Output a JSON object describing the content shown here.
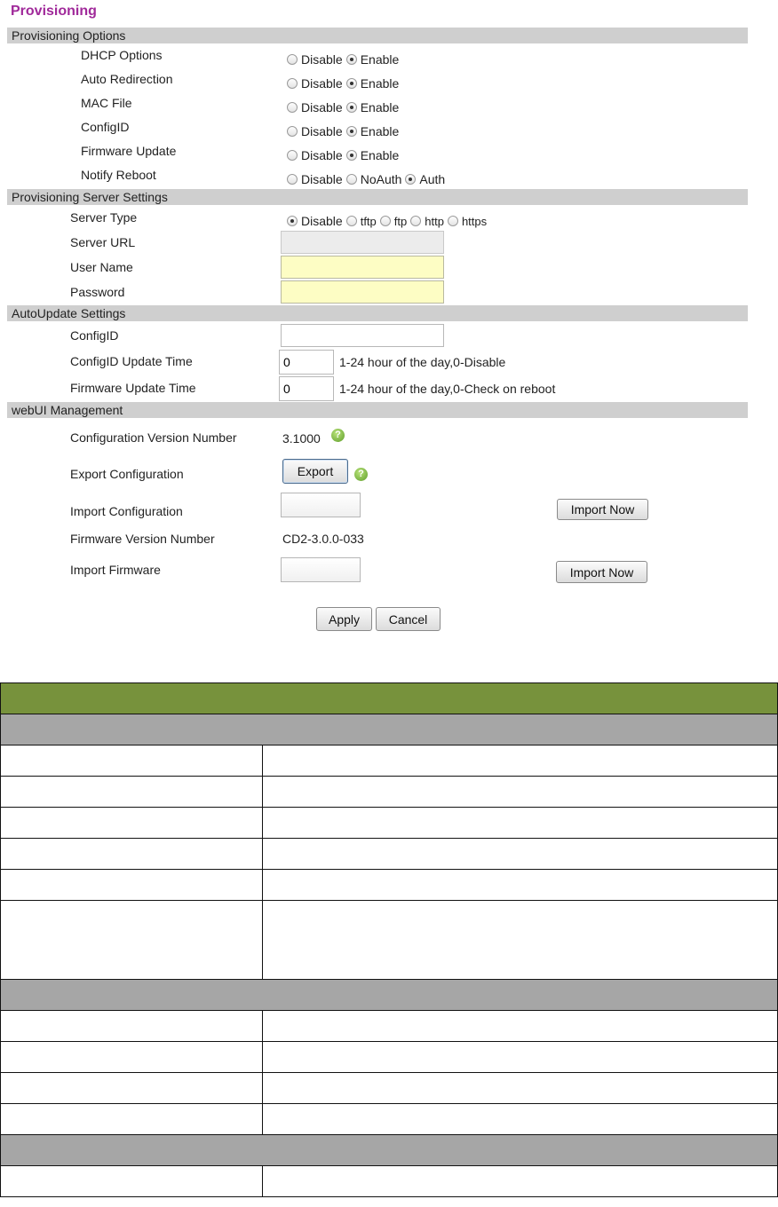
{
  "page_title": "Provisioning",
  "sections": {
    "options": "Provisioning Options",
    "server": "Provisioning Server Settings",
    "autoupdate": "AutoUpdate Settings",
    "webui": "webUI Management"
  },
  "provisioning_options": [
    {
      "label": "DHCP Options",
      "options": [
        "Disable",
        "Enable"
      ],
      "selected": "Enable"
    },
    {
      "label": "Auto Redirection",
      "options": [
        "Disable",
        "Enable"
      ],
      "selected": "Enable"
    },
    {
      "label": "MAC File",
      "options": [
        "Disable",
        "Enable"
      ],
      "selected": "Enable"
    },
    {
      "label": "ConfigID",
      "options": [
        "Disable",
        "Enable"
      ],
      "selected": "Enable"
    },
    {
      "label": "Firmware Update",
      "options": [
        "Disable",
        "Enable"
      ],
      "selected": "Enable"
    },
    {
      "label": "Notify Reboot",
      "options": [
        "Disable",
        "NoAuth",
        "Auth"
      ],
      "selected": "Auth"
    }
  ],
  "server_settings": {
    "server_type_label": "Server Type",
    "server_type_options": [
      "Disable",
      "tftp",
      "ftp",
      "http",
      "https"
    ],
    "server_type_selected": "Disable",
    "server_url_label": "Server URL",
    "server_url_value": "",
    "user_name_label": "User Name",
    "user_name_value": "",
    "password_label": "Password",
    "password_value": ""
  },
  "autoupdate": {
    "configid_label": "ConfigID",
    "configid_value": "",
    "configid_time_label": "ConfigID Update Time",
    "configid_time_value": "0",
    "configid_time_hint": "1-24 hour of the day,0-Disable",
    "fw_time_label": "Firmware Update Time",
    "fw_time_value": "0",
    "fw_time_hint": "1-24 hour of the day,0-Check on reboot"
  },
  "webui": {
    "config_version_label": "Configuration Version Number",
    "config_version_value": "3.1000",
    "export_label": "Export Configuration",
    "export_button": "Export",
    "import_config_label": "Import Configuration",
    "import_now_button": "Import Now",
    "fw_version_label": "Firmware Version Number",
    "fw_version_value": "CD2-3.0.0-033",
    "import_fw_label": "Import Firmware",
    "import_fw_button": "Import Now"
  },
  "footer": {
    "apply": "Apply",
    "cancel": "Cancel"
  },
  "colors": {
    "title": "#a0299a",
    "band": "#cfcfcf",
    "table_header": "#77923c",
    "table_section": "#a6a6a6",
    "input_yellow": "#fdfdc4"
  },
  "icons": {
    "help": "help-question-icon"
  }
}
